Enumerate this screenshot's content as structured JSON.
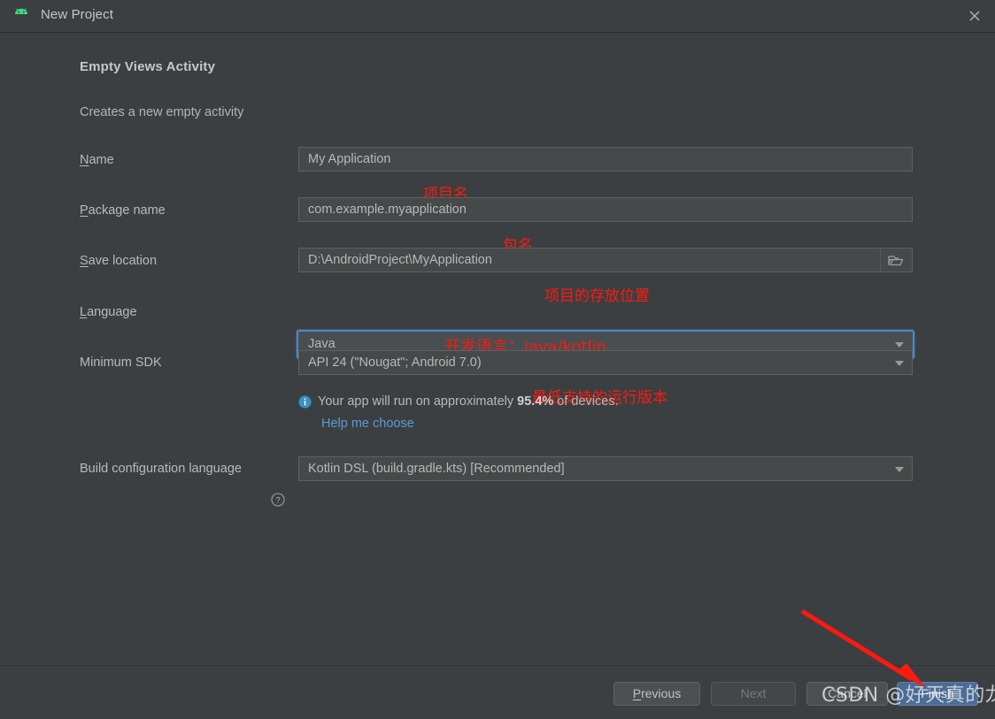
{
  "window": {
    "title": "New Project",
    "app_icon": "android-robot-icon",
    "close_label": "close-icon"
  },
  "colors": {
    "background": "#3c3f41",
    "field_background": "#45494a",
    "accent_blue": "#4a88c7",
    "link_blue": "#5b9ad5",
    "primary_button": "#4a6d96",
    "annotation_red": "#fb1a10",
    "text": "#b9b9b9"
  },
  "page": {
    "heading": "Empty Views Activity",
    "subheading": "Creates a new empty activity"
  },
  "fields": {
    "name": {
      "label_mnemonic": "N",
      "label_rest": "ame",
      "value": "My Application",
      "annotation": "项目名"
    },
    "package_name": {
      "label_mnemonic": "P",
      "label_rest": "ackage name",
      "value": "com.example.myapplication",
      "annotation": "包名"
    },
    "save_location": {
      "label_mnemonic": "S",
      "label_rest": "ave location",
      "value": "D:\\AndroidProject\\MyApplication",
      "annotation": "项目的存放位置",
      "browse_icon": "folder-icon"
    },
    "language": {
      "label_mnemonic": "L",
      "label_rest": "anguage",
      "value": "Java",
      "annotation": "开发语言：java/kotlin",
      "focused": true
    },
    "minimum_sdk": {
      "label": "Minimum SDK",
      "value": "API 24 (\"Nougat\"; Android 7.0)",
      "annotation": "最低支持的运行版本"
    },
    "build_config_language": {
      "label": "Build configuration language",
      "help_icon": "question-mark-icon",
      "value": "Kotlin DSL (build.gradle.kts) [Recommended]"
    }
  },
  "sdk_info": {
    "icon": "info-icon",
    "text_before": "Your app will run on approximately ",
    "percentage": "95.4%",
    "text_after": " of devices.",
    "help_link": "Help me choose"
  },
  "buttons": {
    "previous": {
      "mnemonic": "P",
      "rest": "revious",
      "state": "enabled"
    },
    "next": {
      "label": "Next",
      "state": "disabled"
    },
    "cancel": {
      "label": "Cancel",
      "state": "enabled"
    },
    "finish": {
      "label": "Finish",
      "state": "primary"
    }
  },
  "overlay": {
    "arrow": "red-arrow-pointing-to-finish",
    "watermark": "CSDN @好天真的龙"
  }
}
